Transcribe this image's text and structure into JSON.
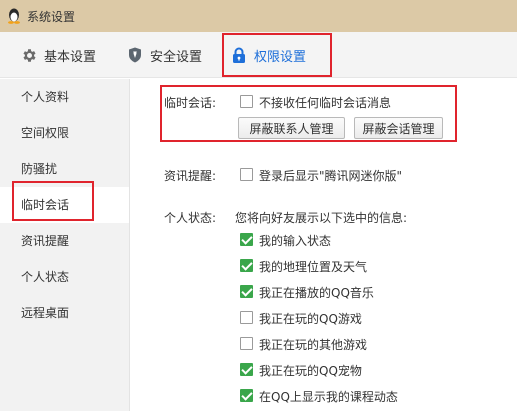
{
  "window": {
    "title": "系统设置",
    "app_icon": "qq-penguin-icon"
  },
  "tabs": [
    {
      "label": "基本设置",
      "icon": "gear-icon"
    },
    {
      "label": "安全设置",
      "icon": "shield-icon"
    },
    {
      "label": "权限设置",
      "icon": "lock-icon",
      "active": true
    }
  ],
  "sidebar": {
    "items": [
      {
        "label": "个人资料"
      },
      {
        "label": "空间权限"
      },
      {
        "label": "防骚扰"
      },
      {
        "label": "临时会话",
        "active": true
      },
      {
        "label": "资讯提醒"
      },
      {
        "label": "个人状态"
      },
      {
        "label": "远程桌面"
      }
    ]
  },
  "temp_session": {
    "label": "临时会话:",
    "reject_label": "不接收任何临时会话消息",
    "reject_checked": false,
    "block_contacts_button": "屏蔽联系人管理",
    "block_sessions_button": "屏蔽会话管理"
  },
  "news": {
    "label": "资讯提醒:",
    "option_label": "登录后显示\"腾讯网迷你版\"",
    "option_checked": false
  },
  "status": {
    "label": "个人状态:",
    "intro": "您将向好友展示以下选中的信息:",
    "options": [
      {
        "label": "我的输入状态",
        "checked": true
      },
      {
        "label": "我的地理位置及天气",
        "checked": true
      },
      {
        "label": "我正在播放的QQ音乐",
        "checked": true
      },
      {
        "label": "我正在玩的QQ游戏",
        "checked": false
      },
      {
        "label": "我正在玩的其他游戏",
        "checked": false
      },
      {
        "label": "我正在玩的QQ宠物",
        "checked": true
      },
      {
        "label": "在QQ上显示我的课程动态",
        "checked": true
      }
    ]
  },
  "colors": {
    "accent": "#1e6fd9",
    "check": "#3aa64b",
    "annotation": "#e0242d",
    "titlebar": "#dcc9a6"
  }
}
